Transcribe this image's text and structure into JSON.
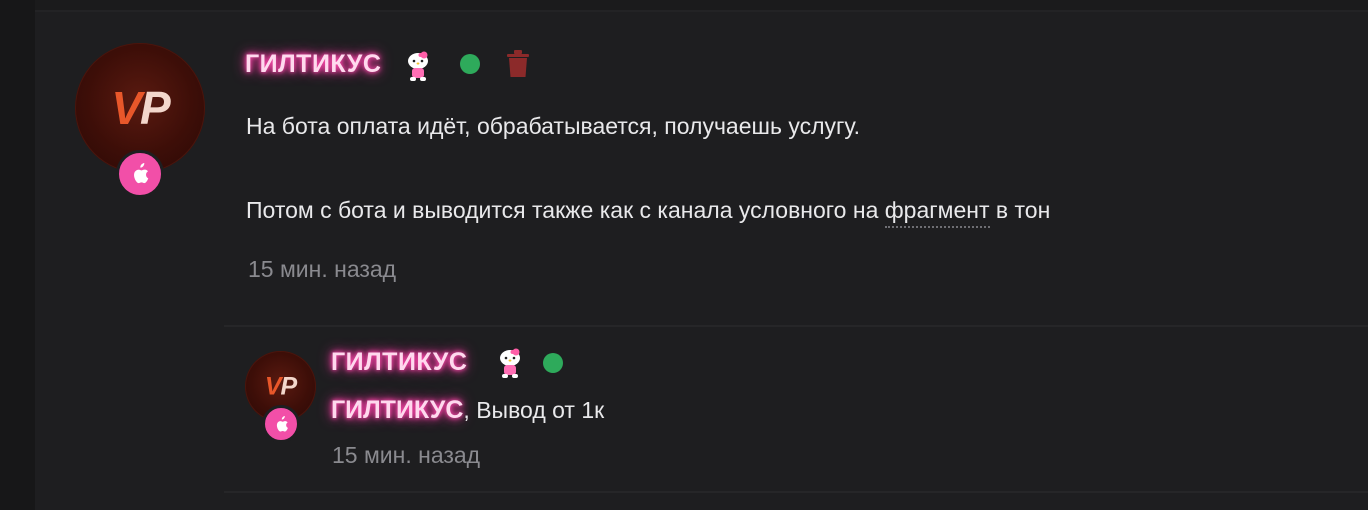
{
  "comment": {
    "author": {
      "name": "ГИЛТИКУС",
      "avatar_logo_left": "V",
      "avatar_logo_right": "P",
      "badge_icon": "apple-icon",
      "status_icon": "hello-kitty-icon",
      "online_color": "#2eaa5b",
      "name_glow_color": "#ff3aa5"
    },
    "text_line1": "На бота оплата идёт, обрабатывается, получаешь услугу.",
    "text_line2_before": "Потом с бота и выводится также как с канала условного на ",
    "text_line2_link": "фрагмент",
    "text_line2_after": " в тон",
    "time": "15 мин. назад",
    "delete_icon": "trash-icon"
  },
  "reply": {
    "author": {
      "name": "ГИЛТИКУС",
      "avatar_logo_left": "V",
      "avatar_logo_right": "P",
      "badge_icon": "apple-icon",
      "status_icon": "hello-kitty-icon"
    },
    "mention": "ГИЛТИКУС",
    "text_after_mention": ", Вывод от 1к",
    "time": "15 мин. назад"
  }
}
